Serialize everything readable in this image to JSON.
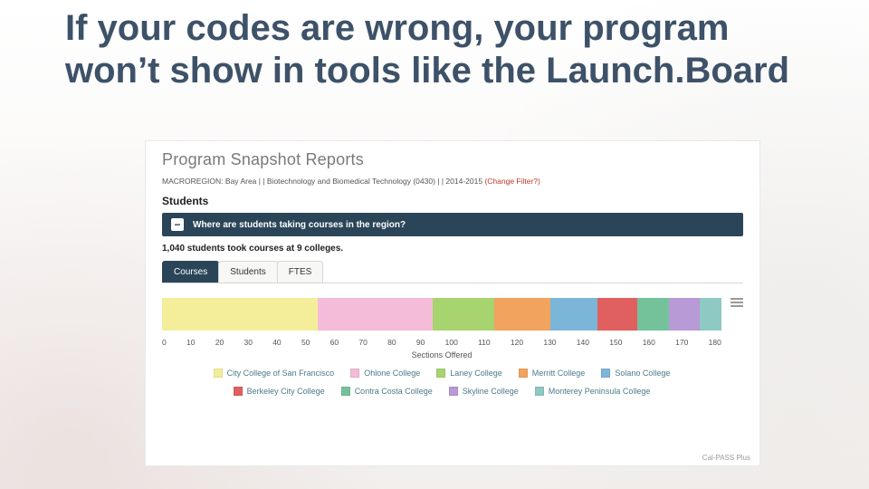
{
  "slide": {
    "title": "If your codes are wrong, your program won’t show in tools like the Launch.Board"
  },
  "report": {
    "title": "Program Snapshot Reports",
    "filter_label": "MACROREGION:",
    "filter_value": "Bay Area | | Biotechnology and Biomedical Technology (0430) | | 2014-2015",
    "change_filter": "(Change Filter?)",
    "section": "Students",
    "question": "Where are students taking courses in the region?",
    "summary": "1,040 students took courses at 9 colleges.",
    "tabs": {
      "courses": "Courses",
      "students": "Students",
      "ftes": "FTES",
      "active": "courses"
    },
    "footer_brand": "Cal-PASS Plus"
  },
  "chart_data": {
    "type": "bar",
    "layout": "stacked-horizontal",
    "title": "",
    "xlabel": "Sections Offered",
    "ylabel": "",
    "xlim": [
      0,
      180
    ],
    "ticks": [
      0,
      10,
      20,
      30,
      40,
      50,
      60,
      70,
      80,
      90,
      100,
      110,
      120,
      130,
      140,
      150,
      160,
      170,
      180
    ],
    "series": [
      {
        "name": "City College of San Francisco",
        "value": 50,
        "color": "#f4ee9a"
      },
      {
        "name": "Ohlone College",
        "value": 37,
        "color": "#f4bcd8"
      },
      {
        "name": "Laney College",
        "value": 20,
        "color": "#a8d46f"
      },
      {
        "name": "Merritt College",
        "value": 18,
        "color": "#f2a35e"
      },
      {
        "name": "Solano College",
        "value": 15,
        "color": "#7bb6d9"
      },
      {
        "name": "Berkeley City College",
        "value": 13,
        "color": "#e06060"
      },
      {
        "name": "Contra Costa College",
        "value": 10,
        "color": "#74c29a"
      },
      {
        "name": "Skyline College",
        "value": 10,
        "color": "#b79ad6"
      },
      {
        "name": "Monterey Peninsula College",
        "value": 7,
        "color": "#8ec9c3"
      }
    ]
  }
}
